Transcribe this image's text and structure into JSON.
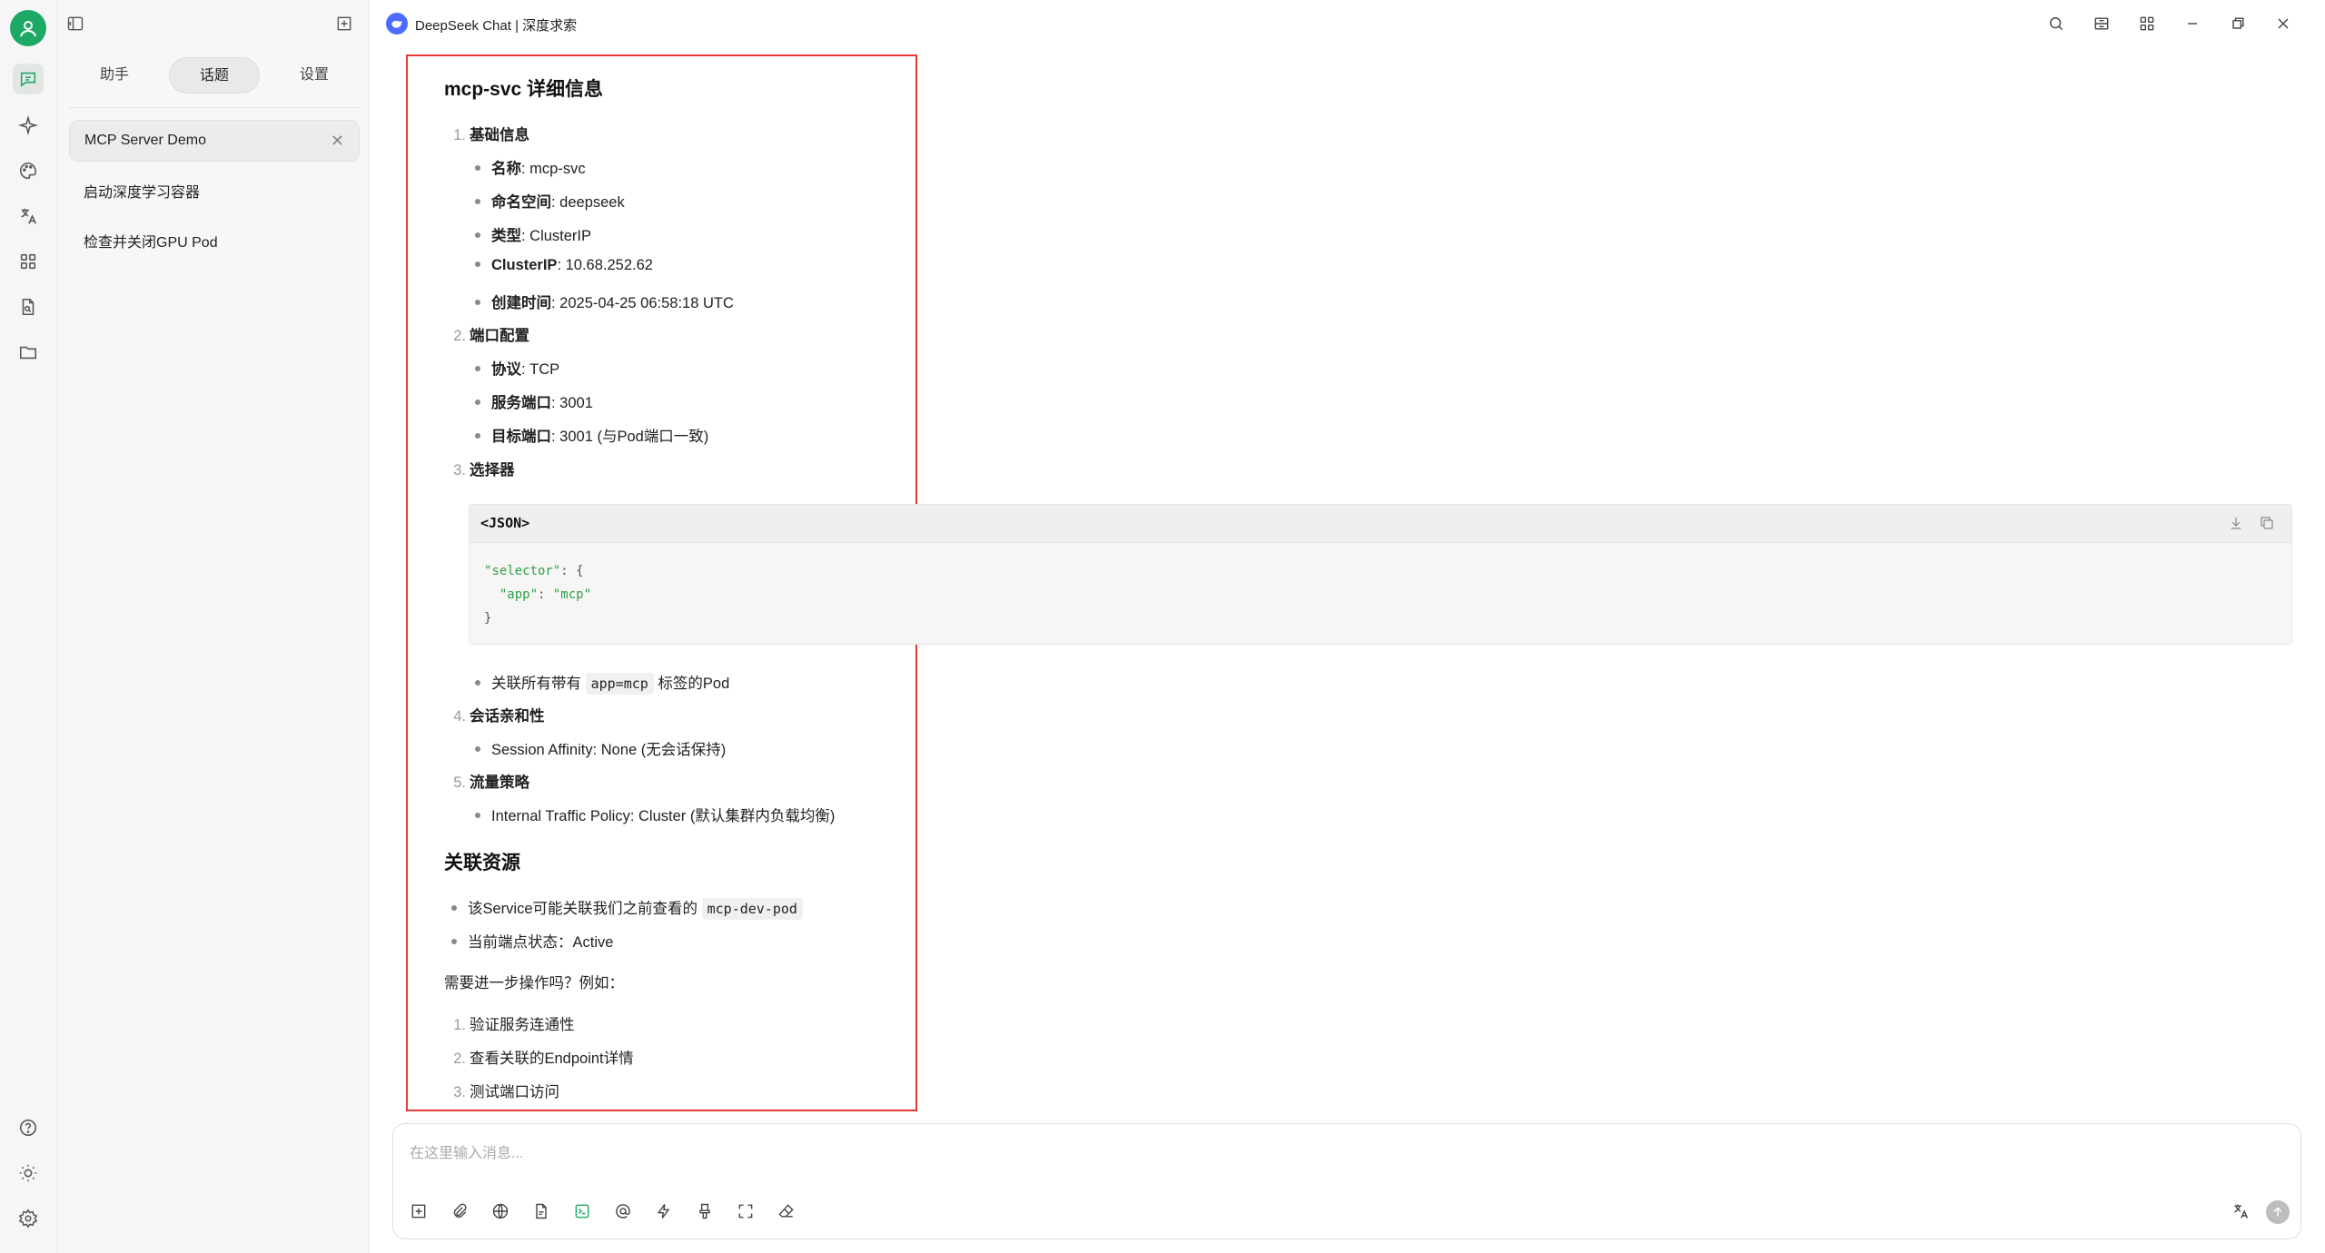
{
  "window": {
    "title": "DeepSeek Chat | 深度求索"
  },
  "sidebar": {
    "tabs": [
      "助手",
      "话题",
      "设置"
    ],
    "active_tab": "话题",
    "topics": [
      {
        "label": "MCP Server Demo",
        "active": true
      },
      {
        "label": "启动深度学习容器",
        "active": false
      },
      {
        "label": "检查并关闭GPU Pod",
        "active": false
      }
    ]
  },
  "message": {
    "heading1": "mcp-svc 详细信息",
    "s1_num": "1.",
    "s1_title": "基础信息",
    "s1_items": [
      {
        "key": "名称",
        "value": ": mcp-svc"
      },
      {
        "key": "命名空间",
        "value": ": deepseek"
      },
      {
        "key": "类型",
        "value": ": ClusterIP"
      },
      {
        "key": "ClusterIP",
        "value": ": 10.68.252.62"
      },
      {
        "key": "创建时间",
        "value": ": 2025-04-25 06:58:18 UTC"
      }
    ],
    "s2_num": "2.",
    "s2_title": "端口配置",
    "s2_items": [
      {
        "key": "协议",
        "value": ": TCP"
      },
      {
        "key": "服务端口",
        "value": ": 3001"
      },
      {
        "key": "目标端口",
        "value": ": 3001 (与Pod端口一致)"
      }
    ],
    "s3_num": "3.",
    "s3_title": "选择器",
    "code": {
      "lang": "<JSON>",
      "line1_key": "\"selector\"",
      "line1_rest": ": {",
      "line2_key": "\"app\"",
      "line2_sep": ": ",
      "line2_val": "\"mcp\"",
      "line3": "}"
    },
    "s3_note_before": "关联所有带有 ",
    "s3_note_code": "app=mcp",
    "s3_note_after": " 标签的Pod",
    "s4_num": "4.",
    "s4_title": "会话亲和性",
    "s4_item": "Session Affinity: None (无会话保持)",
    "s5_num": "5.",
    "s5_title": "流量策略",
    "s5_item": "Internal Traffic Policy: Cluster (默认集群内负载均衡)",
    "heading2": "关联资源",
    "related_1_before": "该Service可能关联我们之前查看的 ",
    "related_1_code": "mcp-dev-pod",
    "related_2": "当前端点状态：Active",
    "followup": "需要进一步操作吗？例如：",
    "options": [
      {
        "num": "1.",
        "text": "验证服务连通性"
      },
      {
        "num": "2.",
        "text": "查看关联的Endpoint详情"
      },
      {
        "num": "3.",
        "text": "测试端口访问"
      }
    ]
  },
  "input": {
    "placeholder": "在这里输入消息..."
  },
  "colors": {
    "brand_green": "#1ea866",
    "highlight_red": "#e53935",
    "deepseek_blue": "#4d6bfe"
  }
}
